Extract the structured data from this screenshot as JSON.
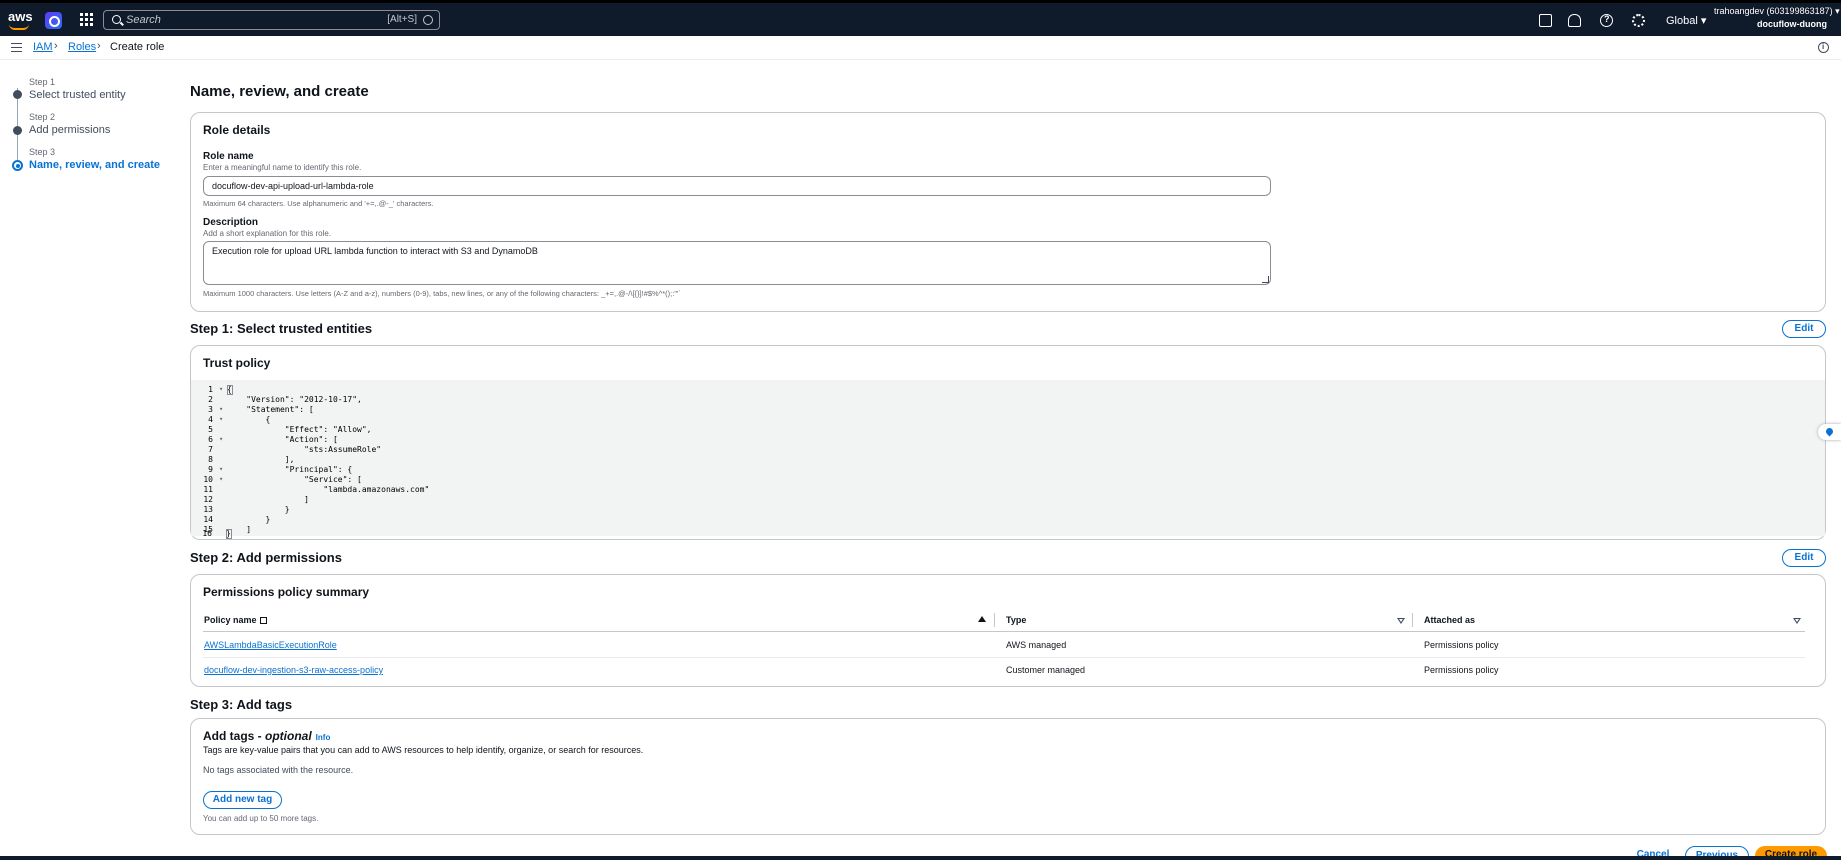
{
  "topnav": {
    "logo": "aws",
    "search_placeholder": "Search",
    "search_shortcut": "[Alt+S]",
    "region": "Global",
    "account_line1": "trahoangdev (603199863187)",
    "account_line2": "docuflow-duong",
    "icons": [
      "cloudshell-icon",
      "bell-icon",
      "help-icon",
      "gear-icon"
    ]
  },
  "breadcrumb": [
    "IAM",
    "Roles",
    "Create role"
  ],
  "steps": [
    {
      "num": "Step 1",
      "name": "Select trusted entity"
    },
    {
      "num": "Step 2",
      "name": "Add permissions"
    },
    {
      "num": "Step 3",
      "name": "Name, review, and create"
    }
  ],
  "page_title": "Name, review, and create",
  "role_details": {
    "title": "Role details",
    "role_name_label": "Role name",
    "role_name_desc": "Enter a meaningful name to identify this role.",
    "role_name_value": "docuflow-dev-api-upload-url-lambda-role",
    "role_name_hint": "Maximum 64 characters. Use alphanumeric and '+=,.@-_' characters.",
    "description_label": "Description",
    "description_desc": "Add a short explanation for this role.",
    "description_value": "Execution role for upload URL lambda function to interact with S3 and DynamoDB",
    "description_hint": "Maximum 1000 characters. Use letters (A-Z and a-z), numbers (0-9), tabs, new lines, or any of the following characters: _+=,.@-/\\[{}]!#$%^*();:\"'`"
  },
  "step1": {
    "title": "Step 1: Select trusted entities",
    "edit_label": "Edit",
    "panel_title": "Trust policy",
    "code_lines": [
      "{",
      "    \"Version\": \"2012-10-17\",",
      "    \"Statement\": [",
      "        {",
      "            \"Effect\": \"Allow\",",
      "            \"Action\": [",
      "                \"sts:AssumeRole\"",
      "            ],",
      "            \"Principal\": {",
      "                \"Service\": [",
      "                    \"lambda.amazonaws.com\"",
      "                ]",
      "            }",
      "        }",
      "    ]",
      "}"
    ]
  },
  "step2": {
    "title": "Step 2: Add permissions",
    "edit_label": "Edit",
    "panel_title": "Permissions policy summary",
    "columns": [
      "Policy name",
      "Type",
      "Attached as"
    ],
    "rows": [
      {
        "name": "AWSLambdaBasicExecutionRole",
        "type": "AWS managed",
        "attached": "Permissions policy"
      },
      {
        "name": "docuflow-dev-ingestion-s3-raw-access-policy",
        "type": "Customer managed",
        "attached": "Permissions policy"
      }
    ]
  },
  "step3": {
    "title": "Step 3: Add tags",
    "panel_title": "Add tags - ",
    "panel_title_optional": "optional",
    "info": "Info",
    "desc": "Tags are key-value pairs that you can add to AWS resources to help identify, organize, or search for resources.",
    "empty": "No tags associated with the resource.",
    "add_button": "Add new tag",
    "limit_hint": "You can add up to 50 more tags."
  },
  "footer": {
    "cancel": "Cancel",
    "previous": "Previous",
    "create": "Create role"
  }
}
